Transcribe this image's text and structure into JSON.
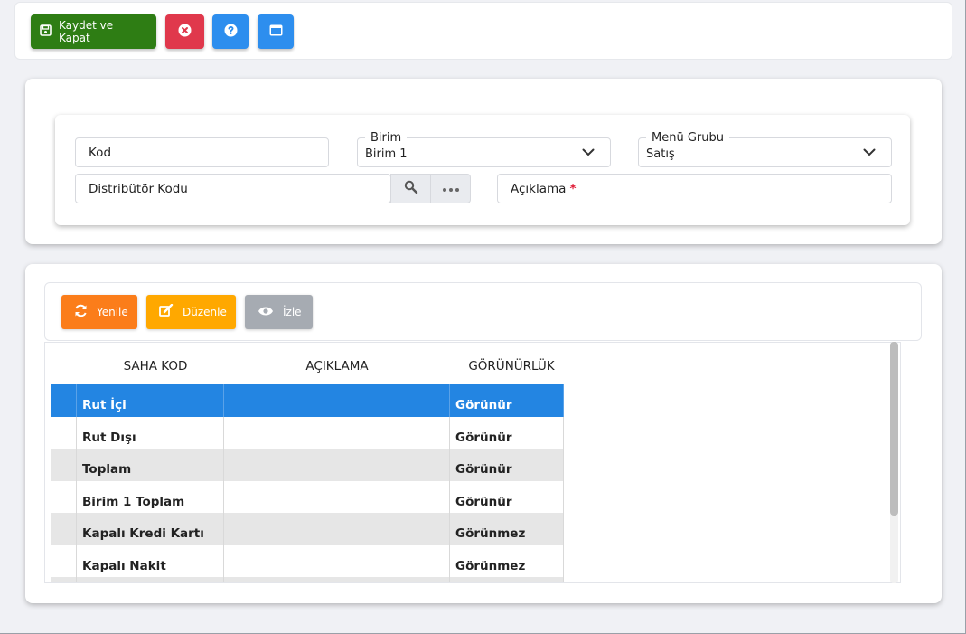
{
  "toolbar": {
    "save_label": "Kaydet ve Kapat",
    "colors": {
      "save": "#2e7d14",
      "close": "#e0384c",
      "help": "#2d8eee",
      "window": "#2d8eee"
    }
  },
  "form": {
    "kod_placeholder": "Kod",
    "birim": {
      "label": "Birim",
      "value": "Birim 1"
    },
    "menu_grubu": {
      "label": "Menü Grubu",
      "value": "Satış"
    },
    "distributor_placeholder": "Distribütör Kodu",
    "aciklama_placeholder": "Açıklama",
    "required_mark": "*"
  },
  "grid_toolbar": {
    "refresh_label": "Yenile",
    "edit_label": "Düzenle",
    "view_label": "İzle"
  },
  "grid": {
    "columns": [
      "SAHA KOD",
      "AÇIKLAMA",
      "GÖRÜNÜRLÜK"
    ],
    "rows": [
      {
        "saha_kod": "Rut İçi",
        "aciklama": "",
        "gorunurluk": "Görünür",
        "selected": true
      },
      {
        "saha_kod": "Rut Dışı",
        "aciklama": "",
        "gorunurluk": "Görünür"
      },
      {
        "saha_kod": "Toplam",
        "aciklama": "",
        "gorunurluk": "Görünür"
      },
      {
        "saha_kod": "Birim 1 Toplam",
        "aciklama": "",
        "gorunurluk": "Görünür"
      },
      {
        "saha_kod": "Kapalı Kredi Kartı",
        "aciklama": "",
        "gorunurluk": "Görünmez"
      },
      {
        "saha_kod": "Kapalı Nakit",
        "aciklama": "",
        "gorunurluk": "Görünmez"
      }
    ]
  }
}
